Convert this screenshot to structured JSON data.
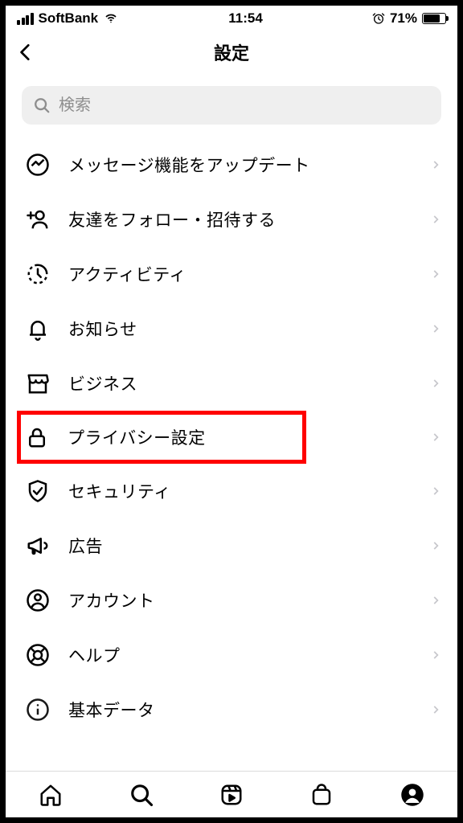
{
  "status": {
    "carrier": "SoftBank",
    "time": "11:54",
    "battery_pct": "71%"
  },
  "header": {
    "title": "設定"
  },
  "search": {
    "placeholder": "検索"
  },
  "menu": [
    {
      "id": "messenger",
      "label": "メッセージ機能をアップデート"
    },
    {
      "id": "follow-invite",
      "label": "友達をフォロー・招待する"
    },
    {
      "id": "activity",
      "label": "アクティビティ"
    },
    {
      "id": "notifications",
      "label": "お知らせ"
    },
    {
      "id": "business",
      "label": "ビジネス"
    },
    {
      "id": "privacy",
      "label": "プライバシー設定",
      "highlighted": true
    },
    {
      "id": "security",
      "label": "セキュリティ"
    },
    {
      "id": "ads",
      "label": "広告"
    },
    {
      "id": "account",
      "label": "アカウント"
    },
    {
      "id": "help",
      "label": "ヘルプ"
    },
    {
      "id": "about",
      "label": "基本データ"
    }
  ]
}
